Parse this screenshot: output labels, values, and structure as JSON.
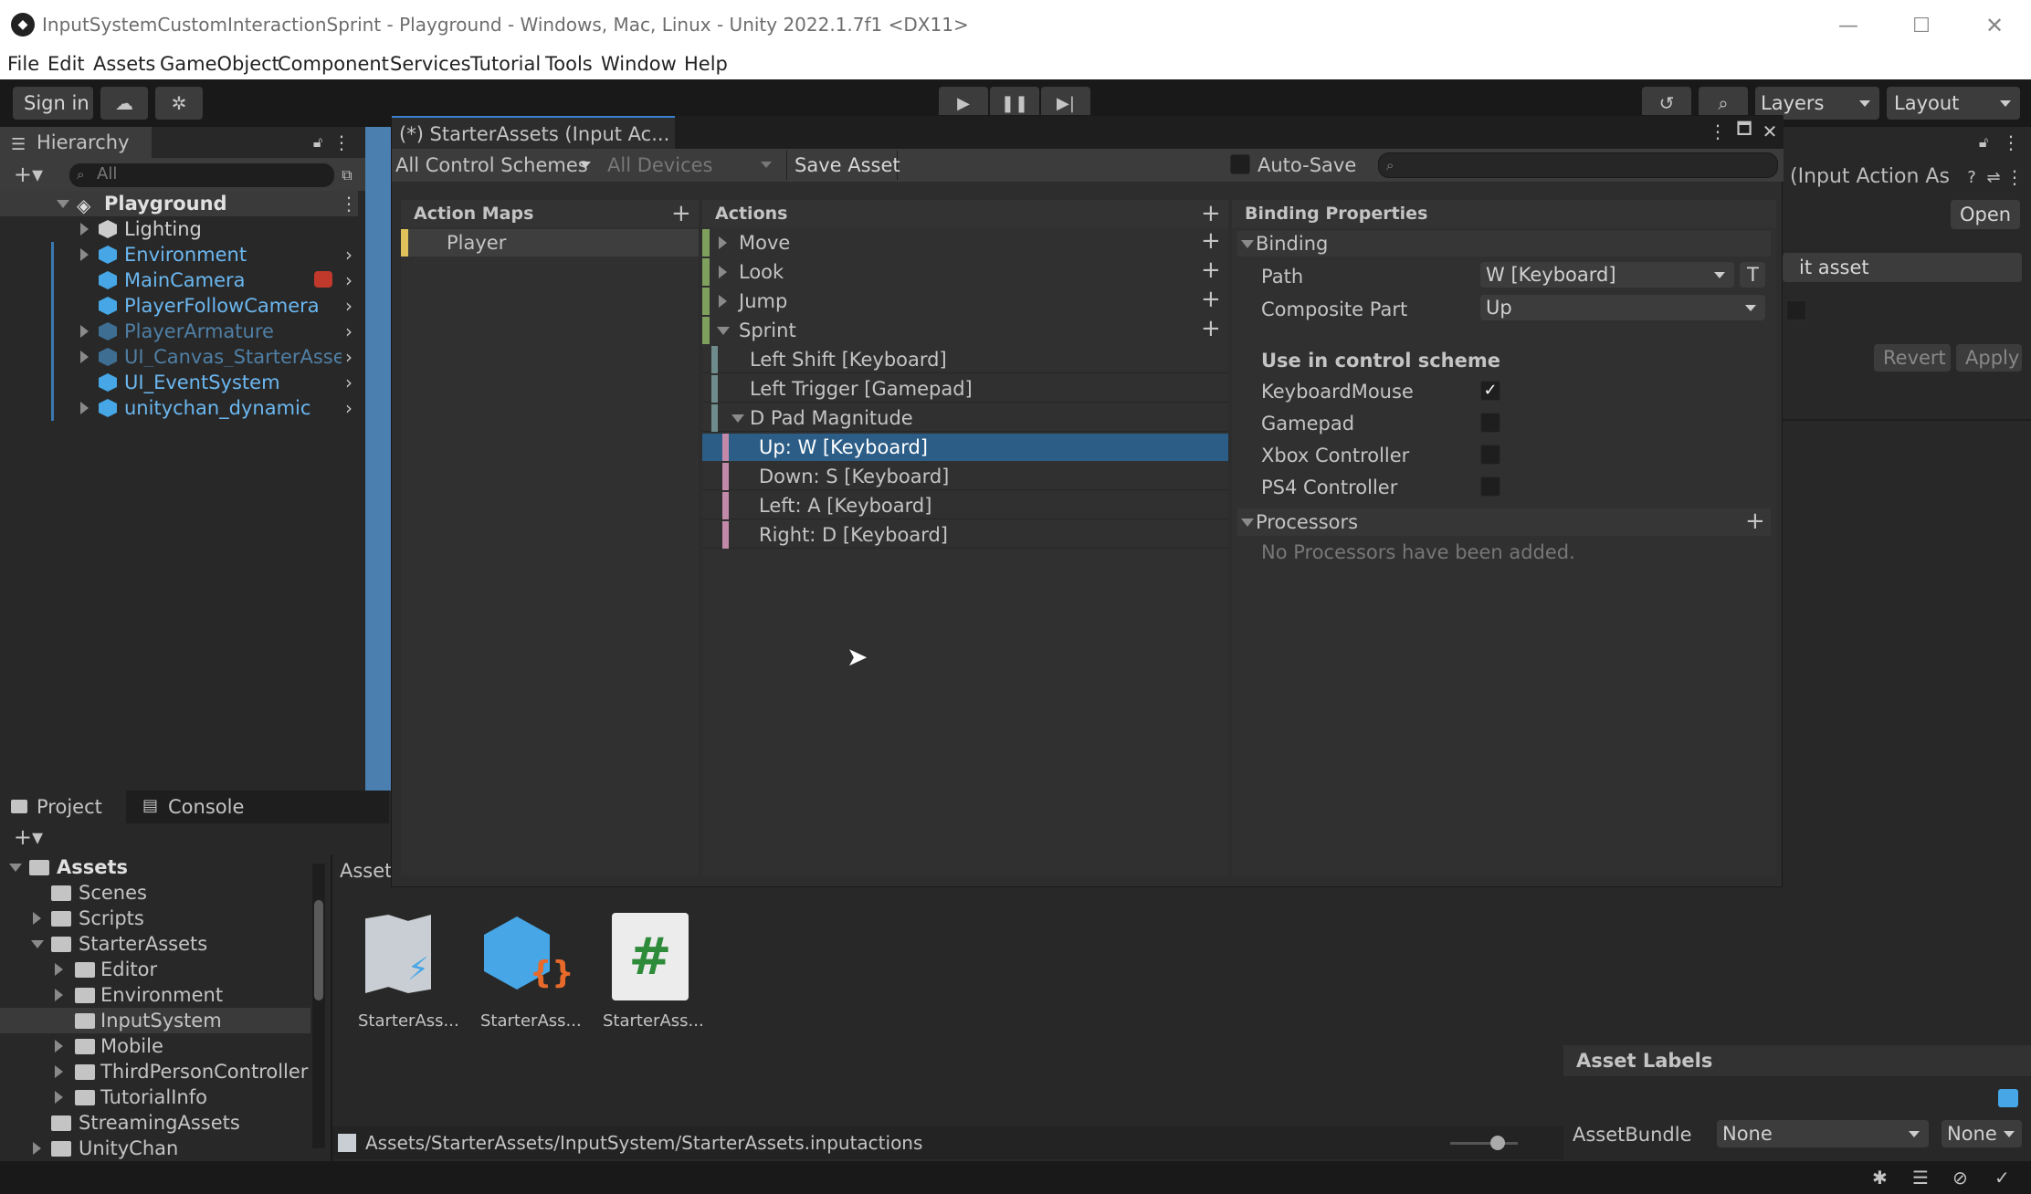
{
  "window": {
    "title": "InputSystemCustomInteractionSprint - Playground - Windows, Mac, Linux - Unity 2022.1.7f1 <DX11>"
  },
  "menu": [
    "File",
    "Edit",
    "Assets",
    "GameObject",
    "Component",
    "Services",
    "Tutorial",
    "Tools",
    "Window",
    "Help"
  ],
  "toolbar": {
    "sign_in": "Sign in",
    "layers": "Layers",
    "layout": "Layout"
  },
  "hierarchy": {
    "tab": "Hierarchy",
    "search_placeholder": "All",
    "scene": "Playground",
    "items": [
      "Lighting",
      "Environment",
      "MainCamera",
      "PlayerFollowCamera",
      "PlayerArmature",
      "UI_Canvas_StarterAssets",
      "UI_EventSystem",
      "unitychan_dynamic"
    ]
  },
  "editor": {
    "title": "(*) StarterAssets (Input Ac...",
    "control_schemes": "All Control Schemes",
    "devices": "All Devices",
    "save_asset": "Save Asset",
    "auto_save": "Auto-Save",
    "action_maps_header": "Action Maps",
    "action_maps": [
      "Player"
    ],
    "actions_header": "Actions",
    "actions": [
      "Move",
      "Look",
      "Jump",
      "Sprint"
    ],
    "bindings": [
      "Left Shift [Keyboard]",
      "Left Trigger [Gamepad]",
      "D Pad Magnitude"
    ],
    "composite_parts": [
      "Up: W [Keyboard]",
      "Down: S [Keyboard]",
      "Left: A [Keyboard]",
      "Right: D [Keyboard]"
    ],
    "binding_properties_header": "Binding Properties",
    "binding_section": "Binding",
    "path_label": "Path",
    "path_value": "W [Keyboard]",
    "path_t": "T",
    "composite_label": "Composite Part",
    "composite_value": "Up",
    "use_in_scheme": "Use in control scheme",
    "schemes": [
      {
        "name": "KeyboardMouse",
        "checked": true
      },
      {
        "name": "Gamepad",
        "checked": false
      },
      {
        "name": "Xbox Controller",
        "checked": false
      },
      {
        "name": "PS4 Controller",
        "checked": false
      }
    ],
    "processors_section": "Processors",
    "no_processors": "No Processors have been added."
  },
  "inspector": {
    "title": "(Input Action As",
    "open": "Open",
    "edit_asset": "it asset",
    "revert": "Revert",
    "apply": "Apply",
    "asset_labels": "Asset Labels",
    "assetbundle_label": "AssetBundle",
    "assetbundle_value": "None",
    "variant_value": "None"
  },
  "project": {
    "tab_project": "Project",
    "tab_console": "Console",
    "root": "Assets",
    "tree": [
      "Scenes",
      "Scripts",
      "StarterAssets",
      "Editor",
      "Environment",
      "InputSystem",
      "Mobile",
      "ThirdPersonController",
      "TutorialInfo",
      "StreamingAssets",
      "UnityChan"
    ],
    "breadcrumb": "Asset",
    "assets": [
      "StarterAss...",
      "StarterAss...",
      "StarterAss..."
    ],
    "path": "Assets/StarterAssets/InputSystem/StarterAssets.inputactions"
  },
  "colors": {
    "selection": "#2c5d87",
    "accent_blue": "#46a6e6",
    "composite_pink": "#c28aa8",
    "action_green": "#7ea05c",
    "map_yellow": "#e1c15a"
  }
}
